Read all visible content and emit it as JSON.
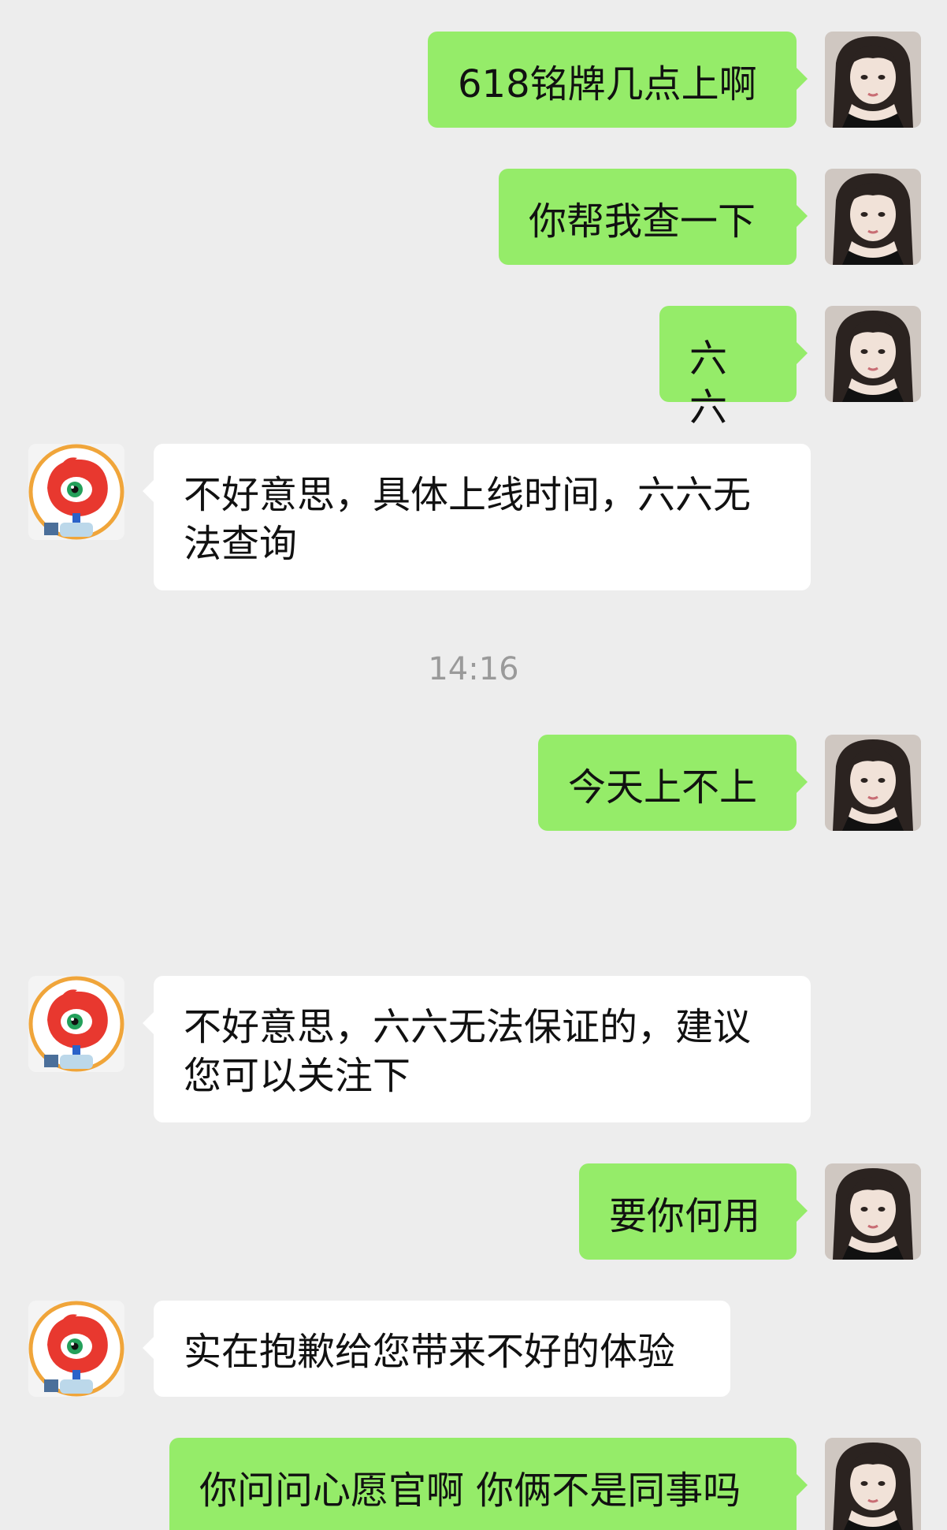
{
  "messages": [
    {
      "id": "m1",
      "side": "out",
      "text": "618铭牌几点上啊"
    },
    {
      "id": "m2",
      "side": "out",
      "text": "你帮我查一下"
    },
    {
      "id": "m3",
      "side": "out",
      "text": "六六"
    },
    {
      "id": "m4",
      "side": "in",
      "text": "不好意思，具体上线时间，六六无法查询"
    },
    {
      "id": "t1",
      "type": "timestamp",
      "text": "14:16"
    },
    {
      "id": "m5",
      "side": "out",
      "text": "今天上不上"
    },
    {
      "id": "m6",
      "side": "in",
      "text": "不好意思，六六无法保证的，建议您可以关注下"
    },
    {
      "id": "m7",
      "side": "out",
      "text": "要你何用"
    },
    {
      "id": "m8",
      "side": "in",
      "text": "实在抱歉给您带来不好的体验"
    },
    {
      "id": "m9",
      "side": "out",
      "text": "你问问心愿官啊 你俩不是同事吗"
    }
  ],
  "icons": {
    "user_avatar": "user-avatar-photo",
    "bot_avatar": "weibo-eye-mascot-icon"
  },
  "colors": {
    "outgoing_bubble": "#95ec69",
    "incoming_bubble": "#ffffff",
    "background": "#ededed",
    "timestamp": "#9a9a9a"
  }
}
